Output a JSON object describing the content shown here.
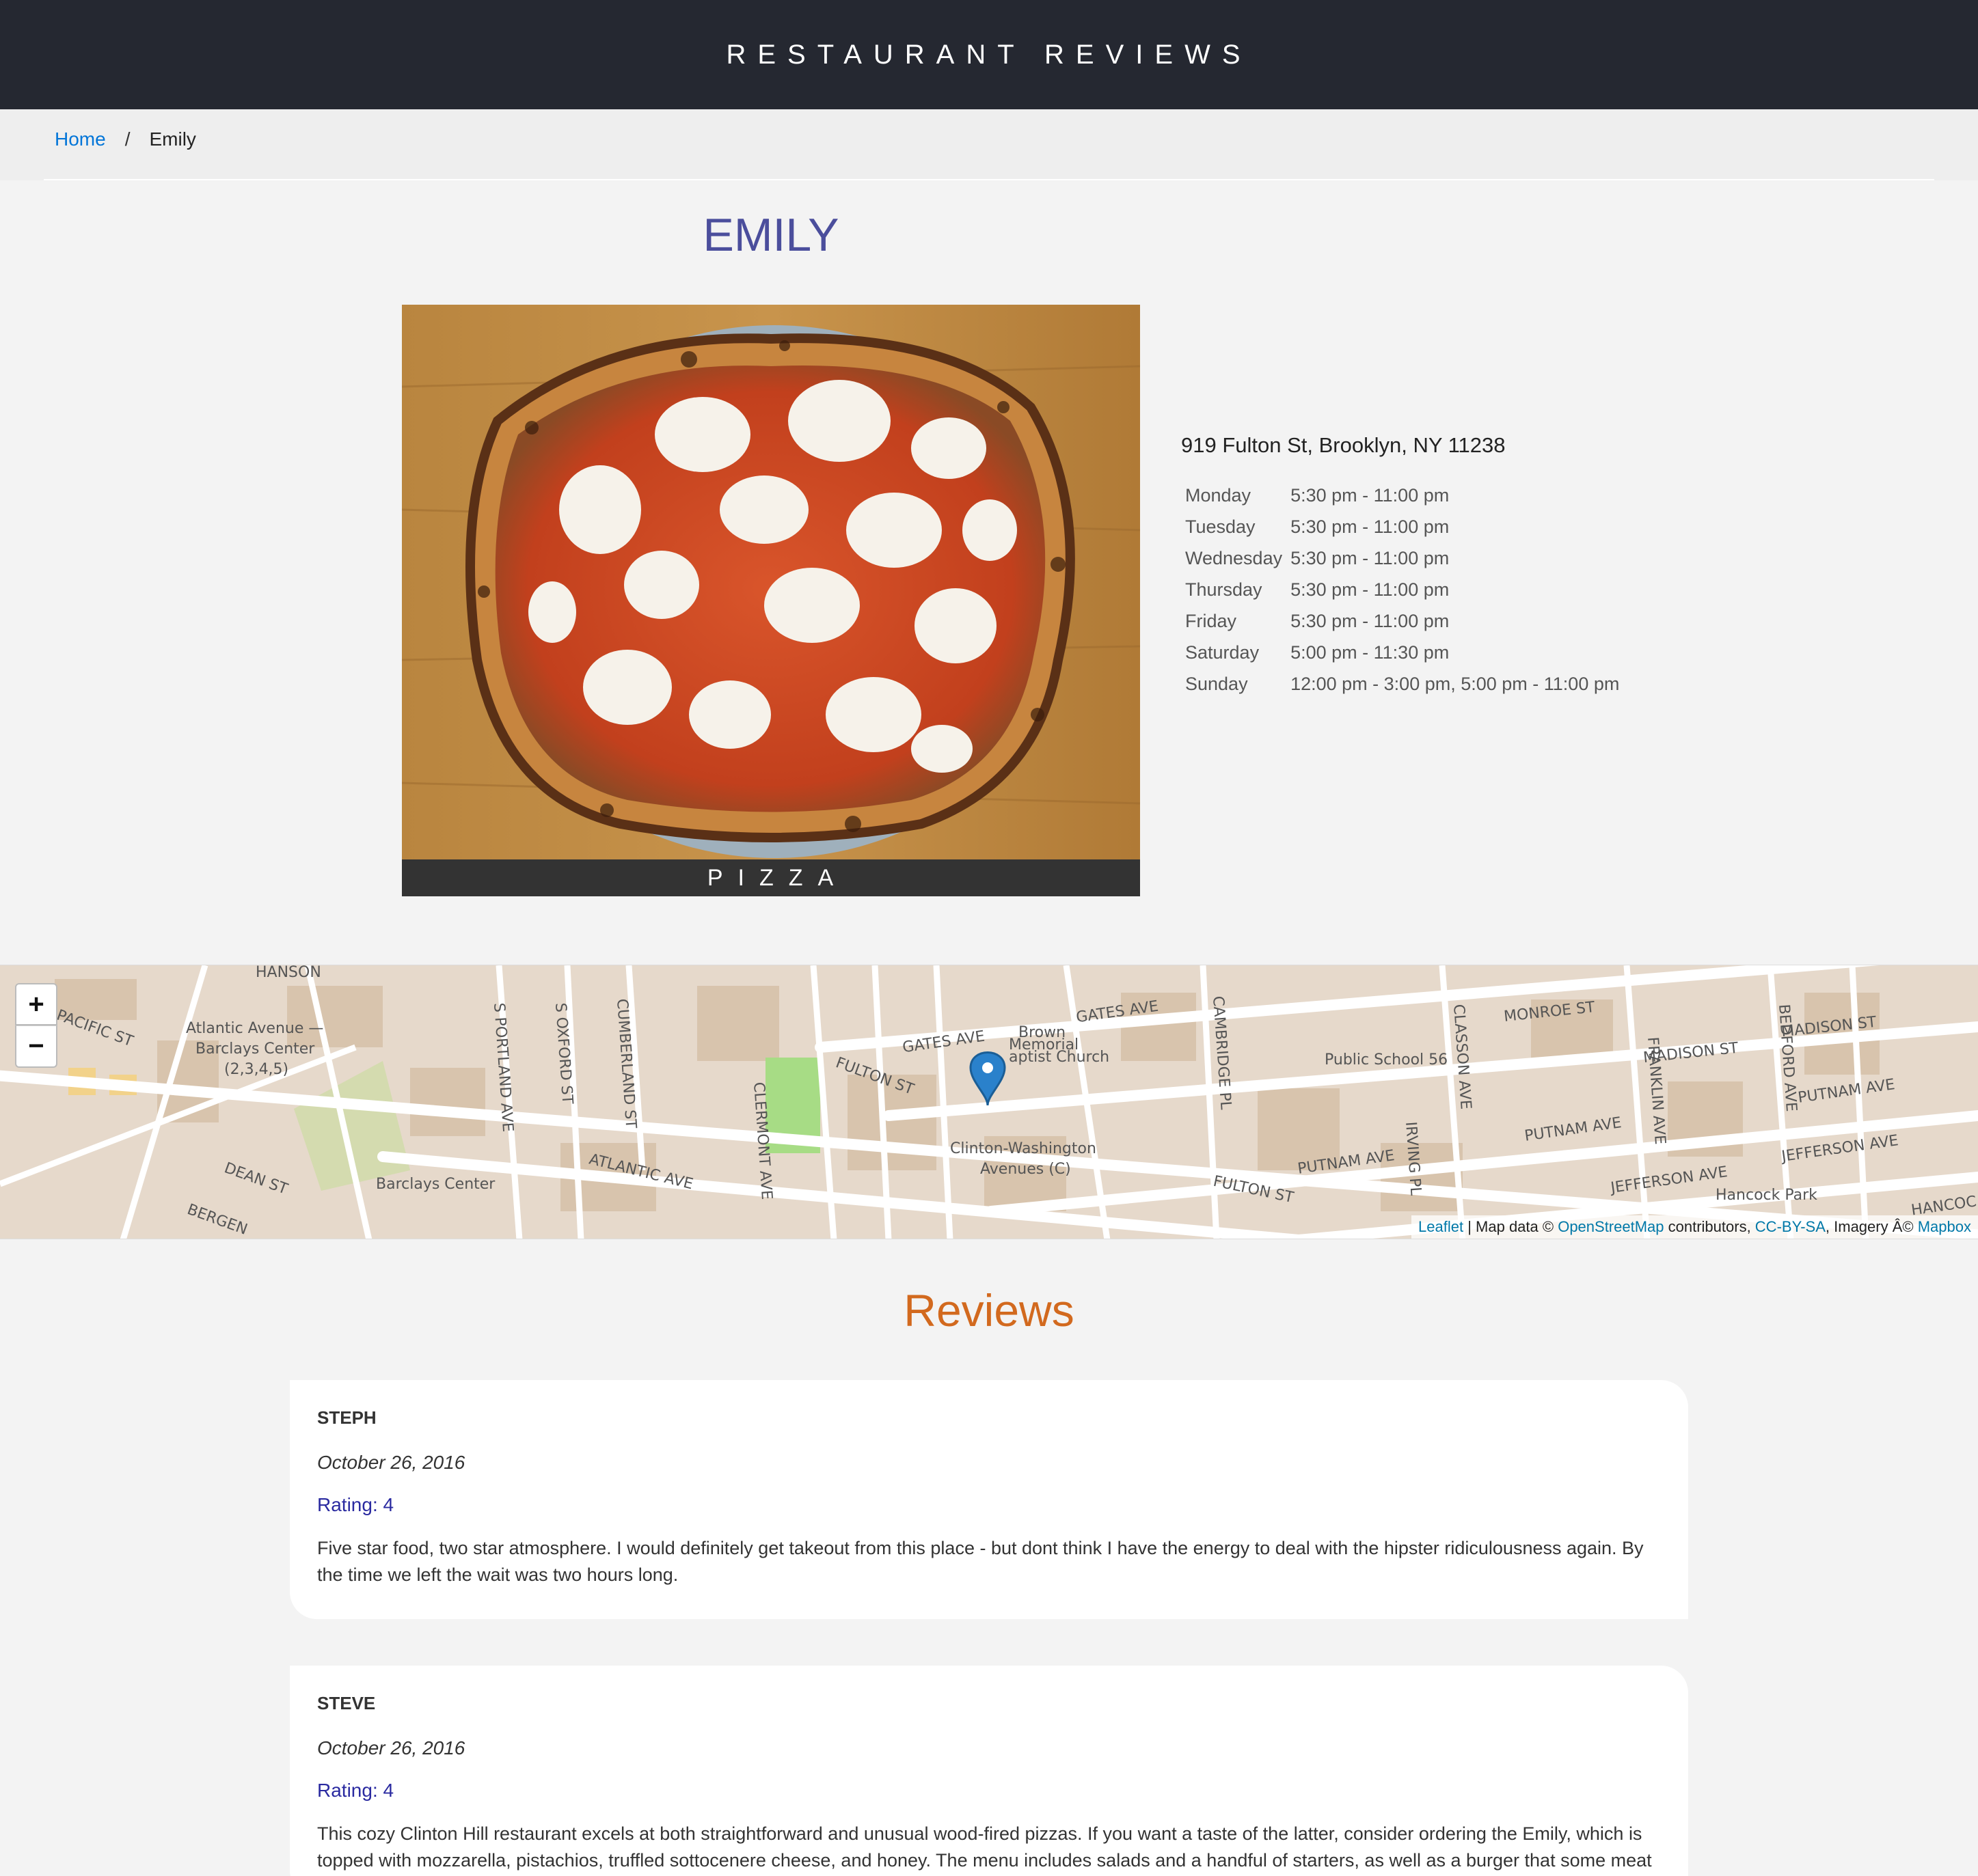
{
  "header": {
    "title": "Restaurant Reviews"
  },
  "breadcrumb": {
    "home": "Home",
    "separator": "/",
    "current": "Emily"
  },
  "restaurant": {
    "name": "EMILY",
    "cuisine": "PIZZA",
    "address": "919 Fulton St, Brooklyn, NY 11238",
    "hours": [
      {
        "day": "Monday",
        "time": "5:30 pm - 11:00 pm"
      },
      {
        "day": "Tuesday",
        "time": "5:30 pm - 11:00 pm"
      },
      {
        "day": "Wednesday",
        "time": "5:30 pm - 11:00 pm"
      },
      {
        "day": "Thursday",
        "time": "5:30 pm - 11:00 pm"
      },
      {
        "day": "Friday",
        "time": "5:30 pm - 11:00 pm"
      },
      {
        "day": "Saturday",
        "time": "5:00 pm - 11:30 pm"
      },
      {
        "day": "Sunday",
        "time": "12:00 pm - 3:00 pm, 5:00 pm - 11:00 pm"
      }
    ]
  },
  "map": {
    "zoom_in": "+",
    "zoom_out": "−",
    "attribution": {
      "leaflet": "Leaflet",
      "text1": " | Map data © ",
      "osm": "OpenStreetMap",
      "text2": " contributors, ",
      "license": "CC-BY-SA",
      "text3": ", Imagery Â© ",
      "mapbox": "Mapbox"
    },
    "labels": {
      "atlantic_terminal": "Atlantic Avenue —",
      "atlantic_terminal2": "Barclays Center",
      "atlantic_terminal3": "(2,3,4,5)",
      "barclays": "Barclays Center",
      "clinton_washington": "Clinton-Washington",
      "clinton_washington2": "Avenues (C)",
      "church": "Brown",
      "church2": "Memorial",
      "church3": "aptist Church",
      "school": "Public School 56",
      "hancock_park": "Hancock Park",
      "fulton_st": "FULTON ST",
      "fulton_st2": "FULTON ST",
      "atlantic_ave": "ATLANTIC AVE",
      "gates_ave": "GATES AVE",
      "gates_ave2": "GATES AVE",
      "monroe_st": "MONROE ST",
      "madison_st": "MADISON ST",
      "madison_st2": "MADISON ST",
      "putnam_ave": "PUTNAM AVE",
      "putnam_ave2": "PUTNAM AVE",
      "putnam_ave3": "PUTNAM AVE",
      "jefferson_ave": "JEFFERSON AVE",
      "jefferson_ave2": "JEFFERSON AVE",
      "dean_st": "DEAN ST",
      "bergen": "BERGEN",
      "pacific_st": "PACIFIC ST",
      "hanson": "HANSON",
      "clermont": "CLERMONT AVE",
      "cambridge": "CAMBRIDGE PL",
      "classon": "CLASSON AVE",
      "franklin": "FRANKLIN AVE",
      "bedford": "BEDFORD AVE",
      "irving": "IRVING PL",
      "portland": "S PORTLAND AVE",
      "oxford": "S OXFORD ST",
      "cumberland": "CUMBERLAND ST",
      "hancock": "HANCOC"
    }
  },
  "reviews_title": "Reviews",
  "reviews": [
    {
      "name": "Steph",
      "date": "October 26, 2016",
      "rating": "Rating: 4",
      "comments": "Five star food, two star atmosphere. I would definitely get takeout from this place - but dont think I have the energy to deal with the hipster ridiculousness again. By the time we left the wait was two hours long."
    },
    {
      "name": "Steve",
      "date": "October 26, 2016",
      "rating": "Rating: 4",
      "comments": "This cozy Clinton Hill restaurant excels at both straightforward and unusual wood-fired pizzas. If you want a taste of the latter, consider ordering the Emily, which is topped with mozzarella, pistachios, truffled sottocenere cheese, and honey. The menu includes salads and a handful of starters, as well as a burger that some meat connoisseurs consider to be among the best in the city."
    }
  ],
  "colors": {
    "header_bg": "#252831",
    "name": "#4b4e9c",
    "reviews_title": "#d2691e",
    "rating": "#2a2aa0",
    "link": "#0275d8"
  }
}
